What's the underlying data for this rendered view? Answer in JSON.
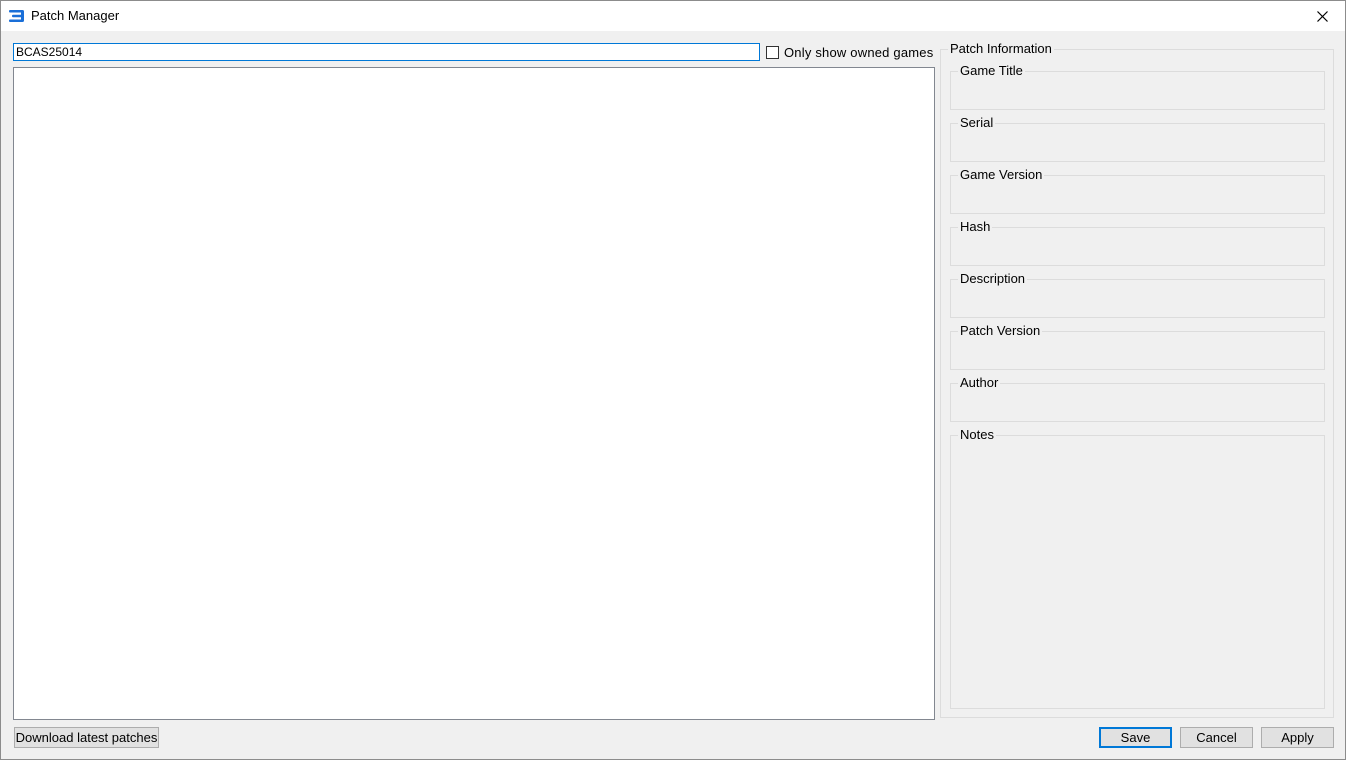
{
  "window": {
    "title": "Patch Manager",
    "icon": "rpcs3-app-icon",
    "close_icon": "close-icon"
  },
  "filter": {
    "search_value": "BCAS25014",
    "only_owned_label": "Only show owned games",
    "only_owned_checked": false
  },
  "patch_list": {
    "items": []
  },
  "patch_info": {
    "group_title": "Patch Information",
    "fields": {
      "game_title": "Game Title",
      "serial": "Serial",
      "game_version": "Game Version",
      "hash": "Hash",
      "description": "Description",
      "patch_version": "Patch Version",
      "author": "Author",
      "notes": "Notes"
    }
  },
  "buttons": {
    "download": "Download latest patches",
    "save": "Save",
    "cancel": "Cancel",
    "apply": "Apply"
  },
  "colors": {
    "accent": "#0078d7",
    "window_bg": "#f0f0f0"
  }
}
